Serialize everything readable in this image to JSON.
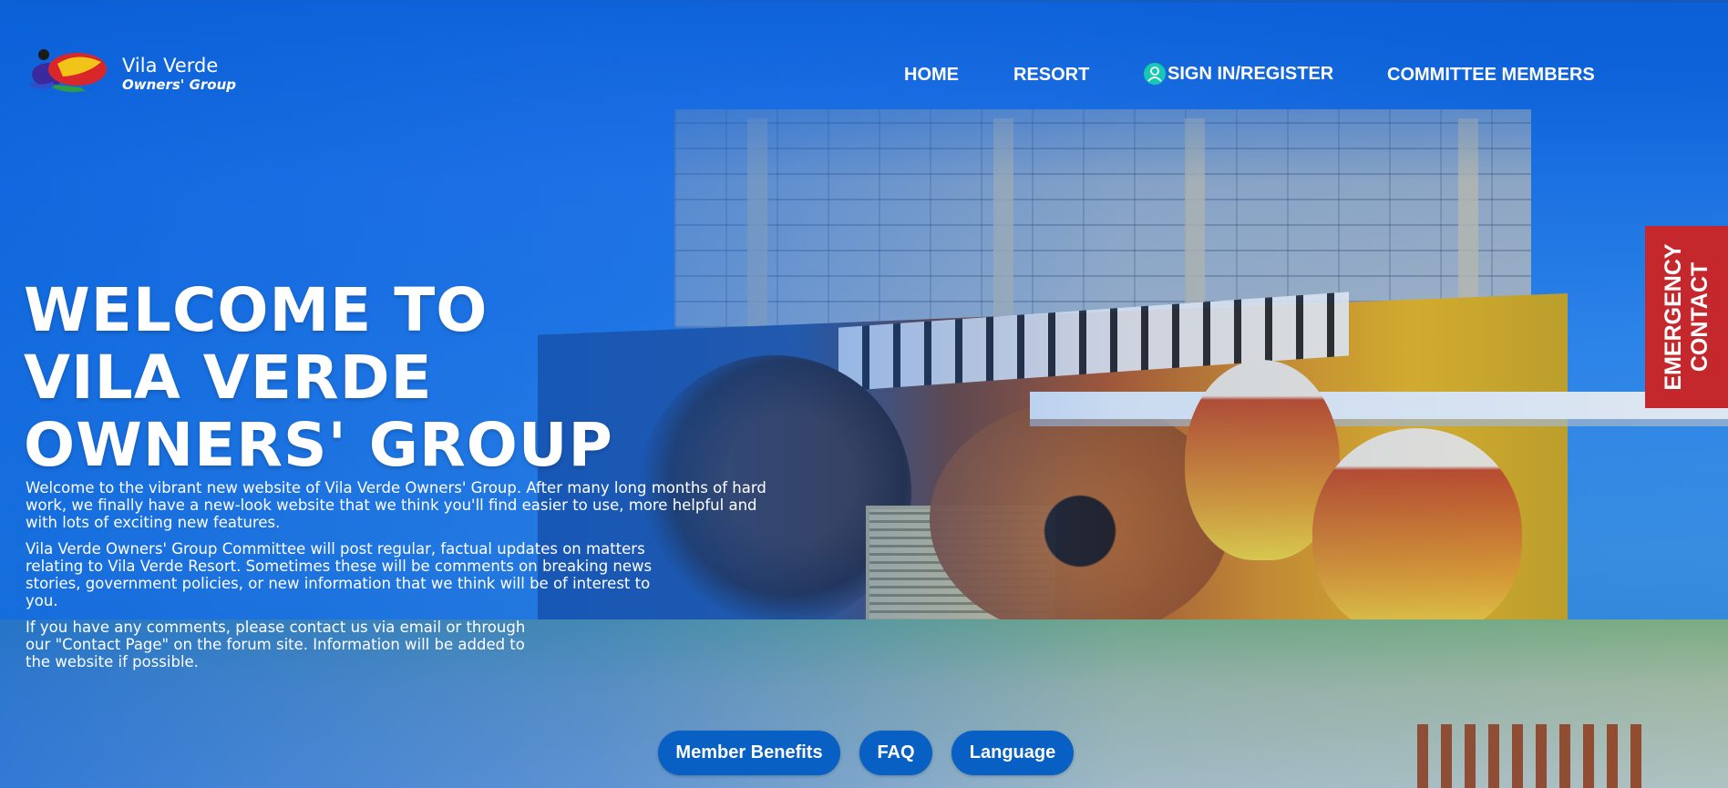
{
  "brand": {
    "title": "Vila Verde",
    "subtitle": "Owners' Group"
  },
  "nav": {
    "items": [
      {
        "label": "HOME"
      },
      {
        "label": "RESORT"
      },
      {
        "label": "SIGN IN/REGISTER",
        "icon": "user-icon"
      },
      {
        "label": "COMMITTEE MEMBERS"
      }
    ]
  },
  "hero": {
    "title_lines": [
      "WELCOME TO",
      "VILA VERDE",
      "OWNERS' GROUP"
    ],
    "paragraphs": [
      "Welcome to the vibrant new website of Vila Verde Owners' Group. After many long months of hard work, we finally have a new-look website that we think you'll find easier to use, more helpful and with lots of exciting new features.",
      "Vila Verde Owners' Group Committee will post regular, factual updates on matters relating to Vila Verde Resort. Sometimes these will be comments on breaking news stories, government policies, or new information that we think will be of interest to you.",
      "If you have any comments, please contact us via email or through our \"Contact Page\" on the forum site. Information will be added to the website if possible."
    ]
  },
  "emergency": {
    "line1": "EMERGENCY",
    "line2": "CONTACT",
    "color": "#c4282d"
  },
  "buttons": [
    {
      "label": "Member Benefits"
    },
    {
      "label": "FAQ"
    },
    {
      "label": "Language"
    }
  ],
  "colors": {
    "primary_blue": "#0860c4",
    "emergency_red": "#c4282d",
    "user_icon_teal": "#17c8b2"
  }
}
